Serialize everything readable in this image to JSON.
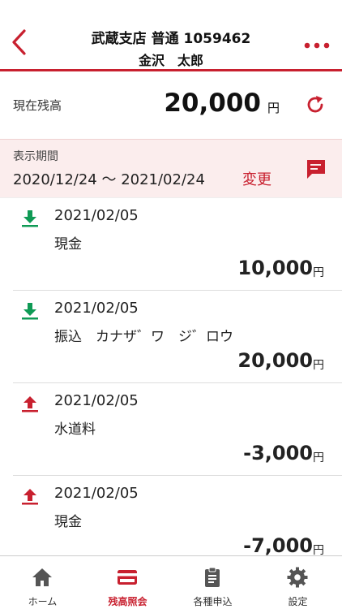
{
  "header": {
    "account_line": "武蔵支店 普通 1059462",
    "holder_name": "金沢　太郎"
  },
  "balance": {
    "label": "現在残高",
    "amount": "20,000",
    "unit": "円"
  },
  "period": {
    "label": "表示期間",
    "range": "2020/12/24 ～ 2021/02/24",
    "change_label": "変更"
  },
  "transactions": [
    {
      "type": "deposit",
      "icon": "download-icon",
      "date": "2021/02/05",
      "description": "現金",
      "amount": "10,000",
      "unit": "円"
    },
    {
      "type": "deposit",
      "icon": "download-icon",
      "date": "2021/02/05",
      "description": "振込　カナザ゛ワ　ジ゛ロウ",
      "amount": "20,000",
      "unit": "円"
    },
    {
      "type": "withdrawal",
      "icon": "upload-icon",
      "date": "2021/02/05",
      "description": "水道料",
      "amount": "-3,000",
      "unit": "円"
    },
    {
      "type": "withdrawal",
      "icon": "upload-icon",
      "date": "2021/02/05",
      "description": "現金",
      "amount": "-7,000",
      "unit": "円"
    }
  ],
  "tabs": [
    {
      "label": "ホーム",
      "icon": "home-icon",
      "active": false
    },
    {
      "label": "残高照会",
      "icon": "card-icon",
      "active": true
    },
    {
      "label": "各種申込",
      "icon": "clipboard-icon",
      "active": false
    },
    {
      "label": "設定",
      "icon": "gear-icon",
      "active": false
    }
  ],
  "colors": {
    "accent": "#c8202f",
    "deposit": "#0f9a55",
    "withdrawal": "#c8202f",
    "period_bg": "#fbeded"
  }
}
